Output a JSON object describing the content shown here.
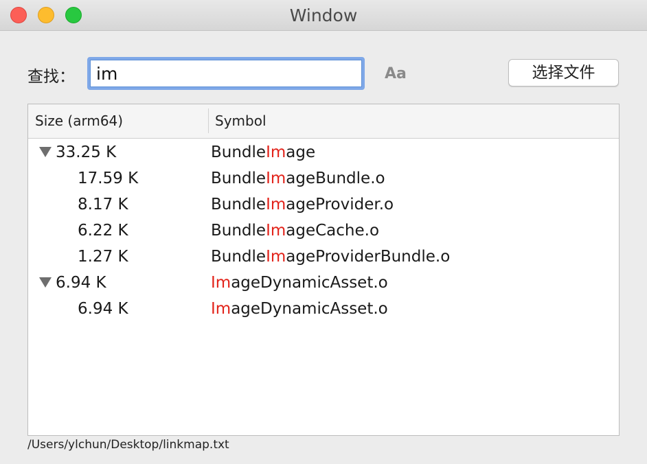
{
  "window": {
    "title": "Window"
  },
  "search": {
    "label": "查找：",
    "value": "im",
    "case_toggle_label": "Aa"
  },
  "toolbar": {
    "choose_file_label": "选择文件"
  },
  "table": {
    "columns": [
      "Size (arm64)",
      "Symbol"
    ],
    "highlight_color": "#e2231a",
    "rows": [
      {
        "size": "33.25 K",
        "sym_pre": "Bundle",
        "sym_match": "Im",
        "sym_post": "age",
        "level": 0,
        "expanded": true
      },
      {
        "size": "17.59 K",
        "sym_pre": "Bundle",
        "sym_match": "Im",
        "sym_post": "ageBundle.o",
        "level": 1
      },
      {
        "size": "8.17 K",
        "sym_pre": "Bundle",
        "sym_match": "Im",
        "sym_post": "ageProvider.o",
        "level": 1
      },
      {
        "size": "6.22 K",
        "sym_pre": "Bundle",
        "sym_match": "Im",
        "sym_post": "ageCache.o",
        "level": 1
      },
      {
        "size": "1.27 K",
        "sym_pre": "Bundle",
        "sym_match": "Im",
        "sym_post": "ageProviderBundle.o",
        "level": 1
      },
      {
        "size": "6.94 K",
        "sym_pre": "",
        "sym_match": "Im",
        "sym_post": "ageDynamicAsset.o",
        "level": 0,
        "expanded": true
      },
      {
        "size": "6.94 K",
        "sym_pre": "",
        "sym_match": "Im",
        "sym_post": "ageDynamicAsset.o",
        "level": 1
      }
    ]
  },
  "status": {
    "file_path": "/Users/ylchun/Desktop/linkmap.txt"
  }
}
